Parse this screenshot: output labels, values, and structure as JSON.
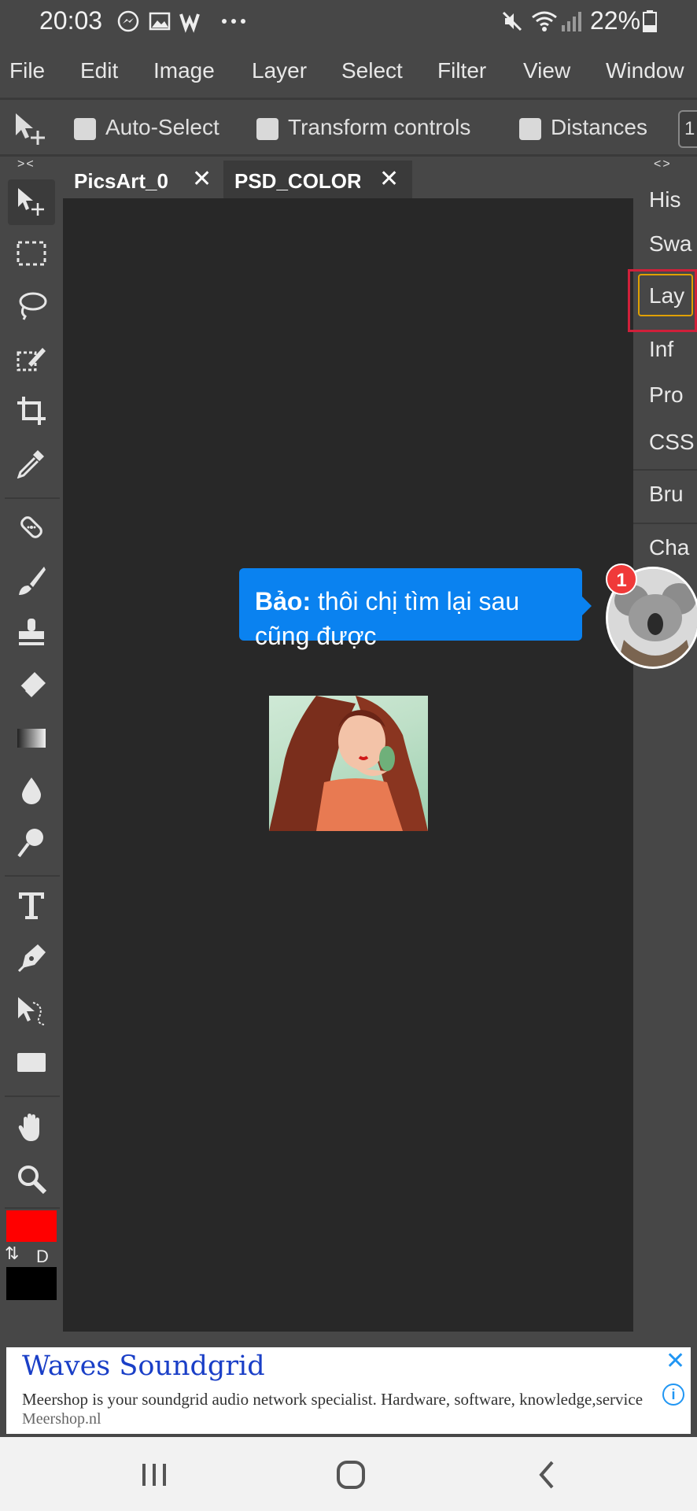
{
  "status_bar": {
    "time": "20:03",
    "battery": "22%",
    "icons": [
      "messenger-icon",
      "gallery-icon",
      "w-icon",
      "more-dots-icon",
      "mute-icon",
      "wifi-icon",
      "signal-icon",
      "battery-icon"
    ]
  },
  "menu": {
    "items": [
      "File",
      "Edit",
      "Image",
      "Layer",
      "Select",
      "Filter",
      "View",
      "Window"
    ]
  },
  "options_bar": {
    "auto_select": "Auto-Select",
    "transform_controls": "Transform controls",
    "distances": "Distances",
    "partial_value": "1"
  },
  "left_toolbar": {
    "collapse": "><",
    "tools": [
      "move",
      "marquee",
      "lasso",
      "quick-select",
      "crop",
      "eyedropper",
      "healing",
      "brush",
      "stamp",
      "eraser",
      "gradient",
      "blur",
      "dodge",
      "text",
      "pen",
      "path-select",
      "shape",
      "hand",
      "zoom"
    ],
    "swap": "⇅",
    "default": "D",
    "fg_color": "#ff0000",
    "bg_color": "#000000"
  },
  "tabs": [
    {
      "label": "PicsArt_0"
    },
    {
      "label": "PSD_COLOR"
    }
  ],
  "right_panel": {
    "collapse": "<>",
    "items": [
      "His",
      "Swa",
      "Lay",
      "Inf",
      "Pro",
      "CSS",
      "Bru",
      "Cha"
    ]
  },
  "chat": {
    "sender": "Bảo:",
    "message": " thôi chị tìm lại sau cũng được",
    "badge": "1"
  },
  "ad": {
    "title": "Waves Soundgrid",
    "text": "Meershop is your soundgrid audio network specialist. Hardware, software, knowledge,service",
    "site": "Meershop.nl",
    "close": "✕",
    "info": "i"
  }
}
